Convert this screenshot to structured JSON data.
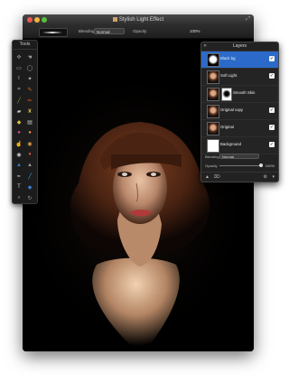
{
  "window": {
    "title": "Stylish Light Effect",
    "resize_icon": "resize-icon"
  },
  "options_bar": {
    "blending_label": "Blending",
    "blending_value": "Normal",
    "opacity_label": "Opacity",
    "opacity_value": "100%"
  },
  "tools_palette": {
    "title": "Tools",
    "tools": [
      {
        "name": "move-icon",
        "glyph": "✥"
      },
      {
        "name": "hand-icon",
        "glyph": "☚"
      },
      {
        "name": "rect-select-icon",
        "glyph": "▭"
      },
      {
        "name": "ellipse-select-icon",
        "glyph": "◯"
      },
      {
        "name": "lasso-icon",
        "glyph": "ℓ"
      },
      {
        "name": "magic-wand-icon",
        "glyph": "✦"
      },
      {
        "name": "crop-icon",
        "glyph": "⌗"
      },
      {
        "name": "eyedropper-icon",
        "glyph": "✎"
      },
      {
        "name": "brush-icon",
        "glyph": "╱"
      },
      {
        "name": "pencil-icon",
        "glyph": "✏"
      },
      {
        "name": "eraser-icon",
        "glyph": "▰"
      },
      {
        "name": "stamp-icon",
        "glyph": "♜"
      },
      {
        "name": "bucket-icon",
        "glyph": "◆"
      },
      {
        "name": "gradient-icon",
        "glyph": "▤"
      },
      {
        "name": "sponge-icon",
        "glyph": "●"
      },
      {
        "name": "burn-icon",
        "glyph": "●"
      },
      {
        "name": "smudge-icon",
        "glyph": "☝"
      },
      {
        "name": "blur-icon",
        "glyph": "◉"
      },
      {
        "name": "eye-icon",
        "glyph": "◉"
      },
      {
        "name": "dodge-icon",
        "glyph": "♦"
      },
      {
        "name": "water-drop-icon",
        "glyph": "▲"
      },
      {
        "name": "sharpen-icon",
        "glyph": "▲"
      },
      {
        "name": "pen-icon",
        "glyph": "✒"
      },
      {
        "name": "wand-line-icon",
        "glyph": "╱"
      },
      {
        "name": "text-icon",
        "glyph": "T"
      },
      {
        "name": "shape-icon",
        "glyph": "◆"
      },
      {
        "name": "zoom-icon",
        "glyph": "⌕"
      },
      {
        "name": "rotate-icon",
        "glyph": "↻"
      }
    ],
    "colors": [
      "#8a8a8a",
      "#9c9c9c",
      "#bdbdbd",
      "#9a9a9a",
      "#9a9a9a",
      "#bdbdbd",
      "#9a9a9a",
      "#d07830",
      "#7bbb3a",
      "#e05a2a",
      "#c9c9c9",
      "#c9a640",
      "#e0c040",
      "#c9c9c9",
      "#d94c9a",
      "#e98a3a",
      "#3a7bd5",
      "#e0a040",
      "#c9c9c9",
      "#e05a2a",
      "#3a7bd5",
      "#9a9a9a",
      "#9a9a9a",
      "#4ab0e0",
      "#c9c9c9",
      "#3a7bd5",
      "#9a9a9a",
      "#9a9a9a"
    ]
  },
  "layers_palette": {
    "title": "Layers",
    "layers": [
      {
        "name": "Black bg",
        "visible": true,
        "selected": true,
        "thumb": "black-white"
      },
      {
        "name": "Soft Light",
        "visible": true,
        "selected": false,
        "thumb": "portrait"
      },
      {
        "name": "Smooth Skin",
        "visible": false,
        "selected": false,
        "thumb": "portrait-mask"
      },
      {
        "name": "Original copy",
        "visible": true,
        "selected": false,
        "thumb": "portrait"
      },
      {
        "name": "Original",
        "visible": true,
        "selected": false,
        "thumb": "portrait"
      },
      {
        "name": "Background",
        "visible": true,
        "selected": false,
        "thumb": "white"
      }
    ],
    "blending_label": "Blending",
    "blending_value": "Normal",
    "opacity_label": "Opacity",
    "opacity_value": "100%",
    "opacity_fraction": 1.0
  }
}
